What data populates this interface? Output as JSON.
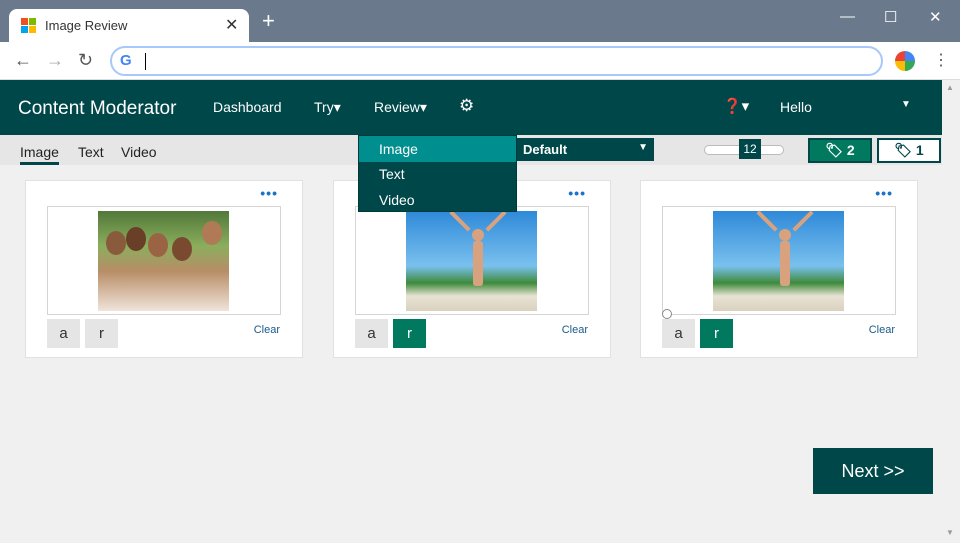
{
  "browser": {
    "tab_title": "Image Review",
    "tab_close": "✕",
    "new_tab": "+",
    "minimize": "—",
    "maximize": "☐",
    "close": "✕",
    "back": "←",
    "forward": "→",
    "reload": "↻",
    "google_g": "G",
    "menu": "⋮"
  },
  "header": {
    "title": "Content Moderator",
    "nav": [
      "Dashboard",
      "Try▾",
      "Review▾"
    ],
    "gear": "⚙",
    "help": "❓▾",
    "user": "Hello",
    "user_caret": "▼"
  },
  "subbar": {
    "tabs": [
      "Image",
      "Text",
      "Video"
    ],
    "team": "Default",
    "team_caret": "▼",
    "slider_value": "12",
    "tags_reviewed": "🏷 2",
    "tags_pending": "🏷 1"
  },
  "dropdown": {
    "items": [
      "Image",
      "Text",
      "Video"
    ]
  },
  "cards": [
    {
      "more": "•••",
      "approve": "a",
      "reject": "r",
      "clear": "Clear",
      "image": "family-photo",
      "rejected": false
    },
    {
      "more": "•••",
      "approve": "a",
      "reject": "r",
      "clear": "Clear",
      "image": "beach-photo",
      "rejected": true
    },
    {
      "more": "•••",
      "approve": "a",
      "reject": "r",
      "clear": "Clear",
      "image": "beach-photo",
      "rejected": true
    }
  ],
  "next_label": "Next >>",
  "colors": {
    "brand": "#00474a",
    "accent": "#00795f",
    "highlight": "#008e8e"
  }
}
